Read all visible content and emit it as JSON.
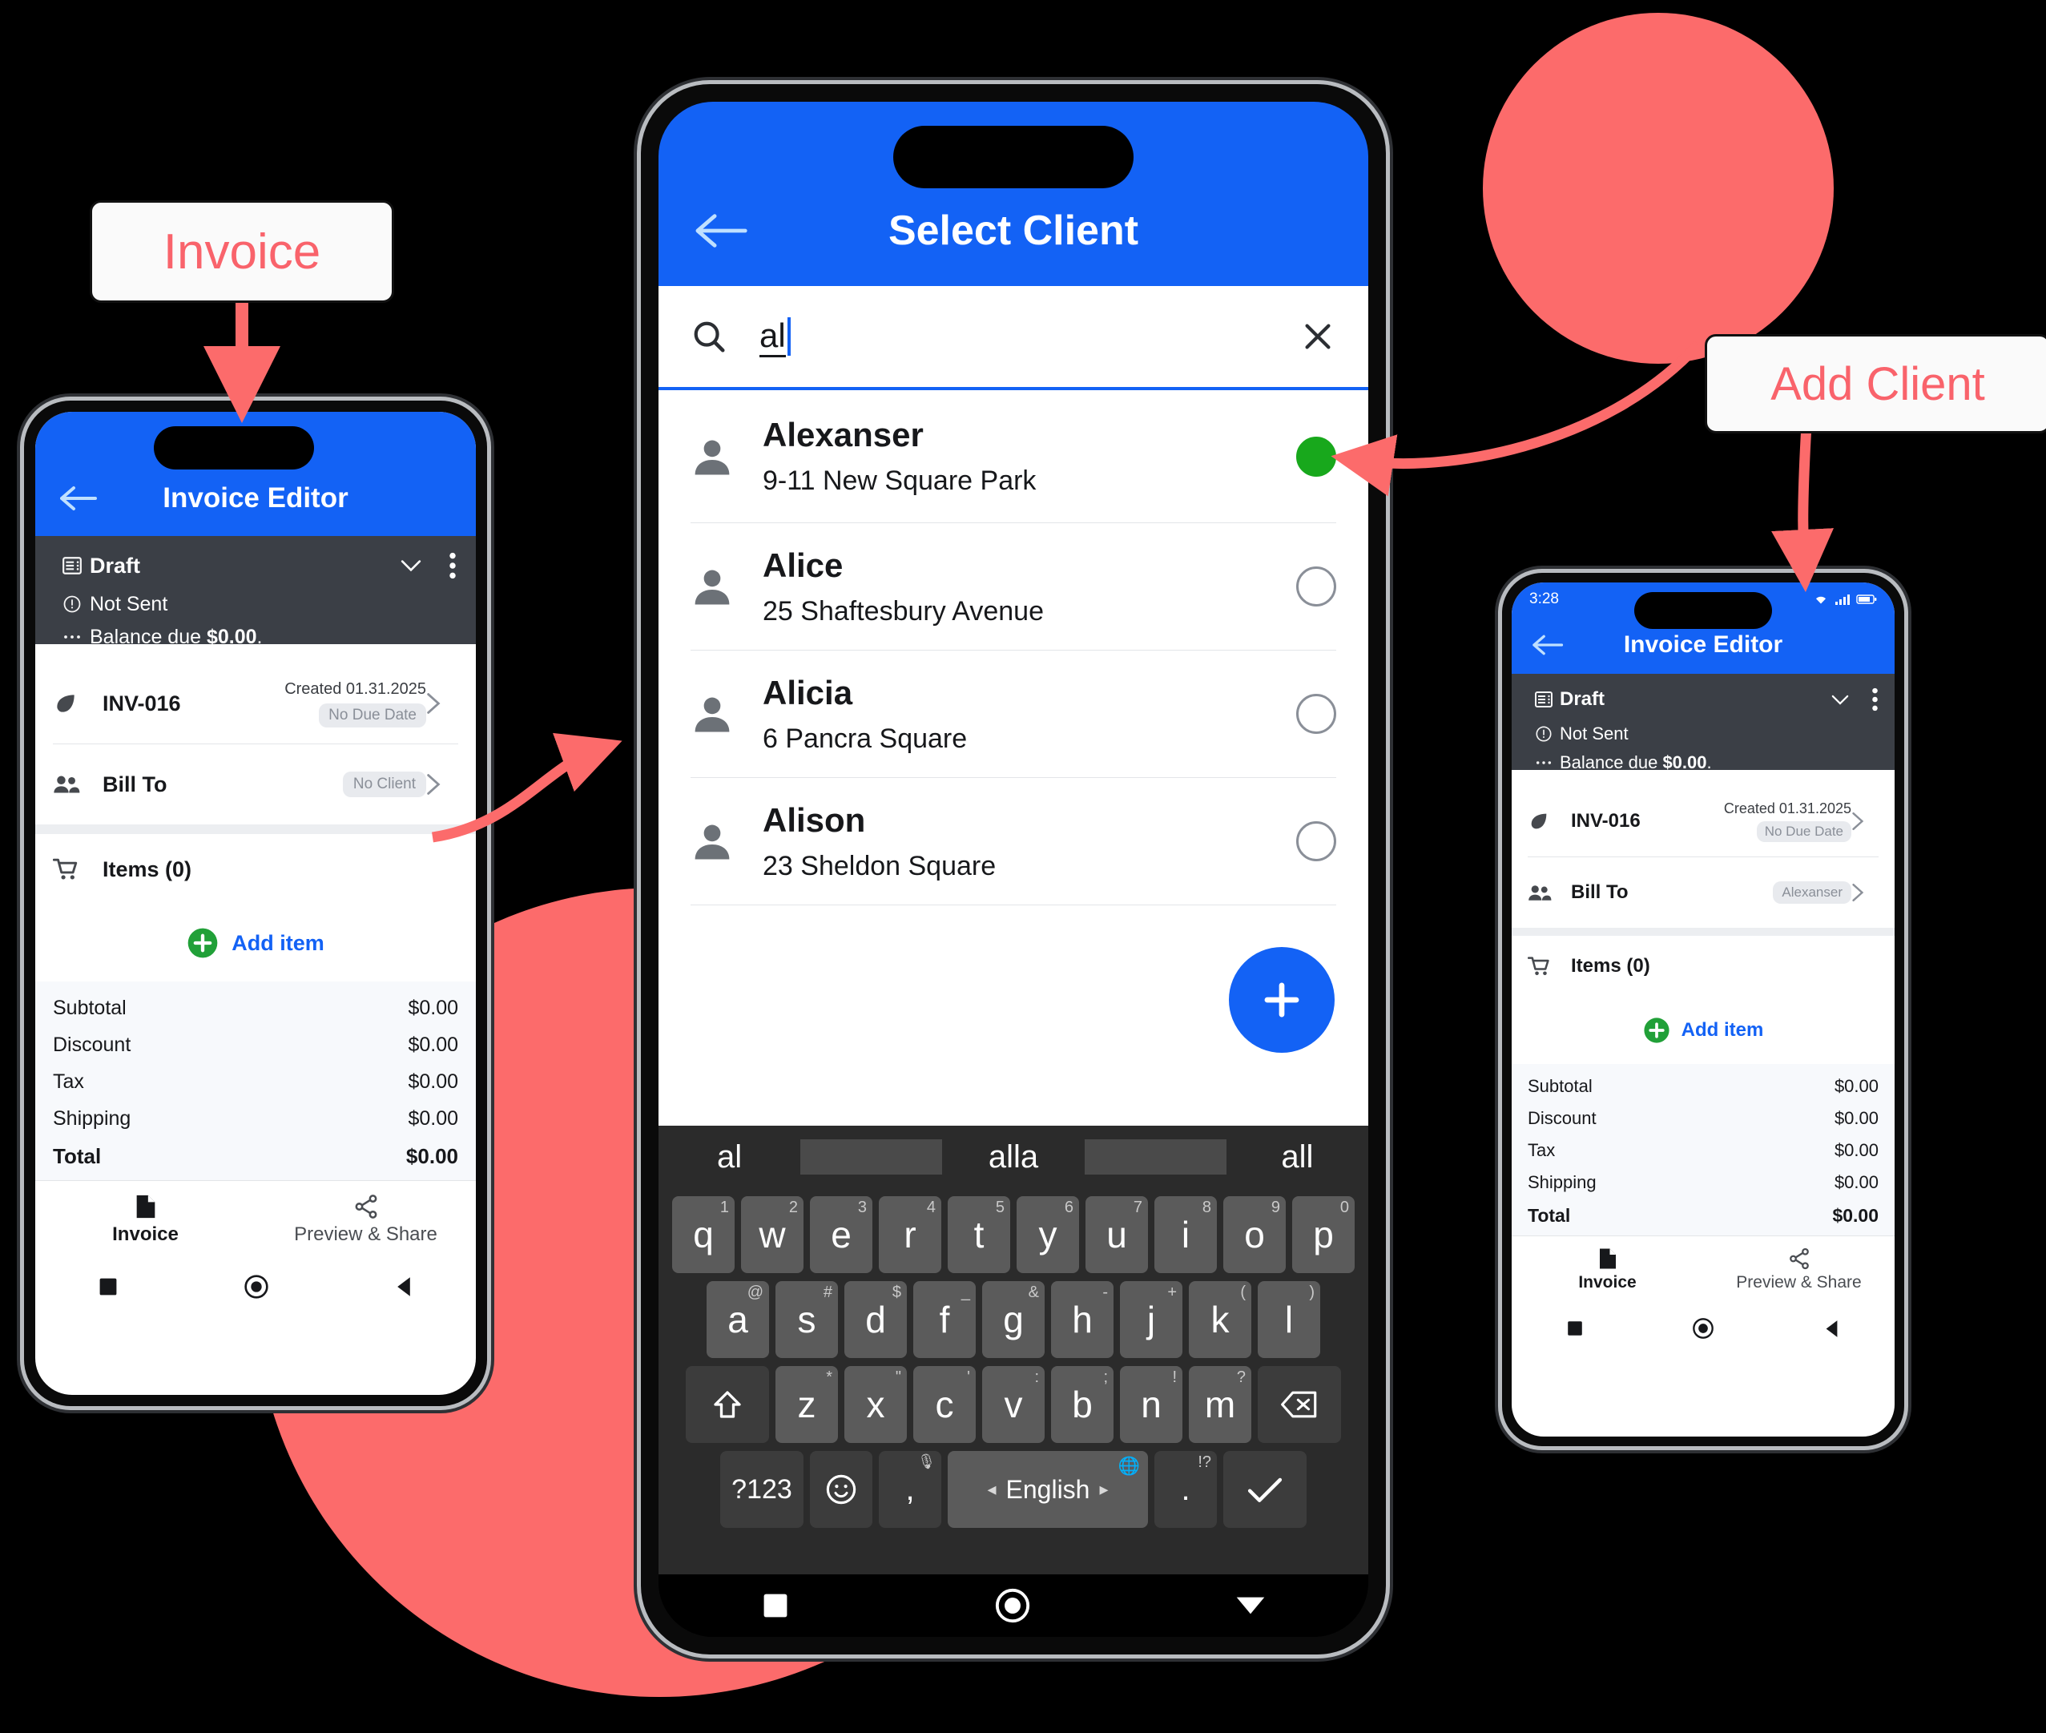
{
  "theme": {
    "brand_blue": "#1362F5",
    "coral": "#FC6B6B",
    "callout_text": "#F9636B",
    "selected_green": "#18A81C",
    "dark_panel": "#3B3F46"
  },
  "callouts": [
    {
      "id": "invoice",
      "label": "Invoice"
    },
    {
      "id": "add_client",
      "label": "Add Client"
    }
  ],
  "invoice_editor": {
    "appbar": {
      "back_icon": "arrow-left-icon",
      "title": "Invoice Editor"
    },
    "status": {
      "doc_icon": "document-list-icon",
      "state": "Draft",
      "chevron_icon": "chevron-down-icon",
      "overflow_icon": "more-vertical-icon",
      "sent_icon": "alert-circle-icon",
      "sent_status": "Not Sent",
      "balance_icon": "ellipsis-icon",
      "balance_label": "Balance due ",
      "balance_amount": "$0.00",
      "balance_suffix": "."
    },
    "rows": [
      {
        "icon": "leaf-icon",
        "label": "INV-016",
        "meta_top": "Created 01.31.2025",
        "meta_chip": "No Due Date",
        "chevron": "chevron-right-icon"
      },
      {
        "icon": "people-icon",
        "label": "Bill To",
        "meta_chip": "No Client",
        "chevron": "chevron-right-icon"
      }
    ],
    "items": {
      "icon": "cart-icon",
      "title": "Items (0)",
      "add_icon": "plus-circle-icon",
      "add_label": "Add item"
    },
    "totals": [
      {
        "label": "Subtotal",
        "value": "$0.00",
        "bold": false
      },
      {
        "label": "Discount",
        "value": "$0.00",
        "bold": false
      },
      {
        "label": "Tax",
        "value": "$0.00",
        "bold": false
      },
      {
        "label": "Shipping",
        "value": "$0.00",
        "bold": false
      },
      {
        "label": "Total",
        "value": "$0.00",
        "bold": true
      }
    ],
    "bottom_tabs": [
      {
        "icon": "invoice-doc-icon",
        "label": "Invoice",
        "active": true
      },
      {
        "icon": "share-icon",
        "label": "Preview & Share",
        "active": false
      }
    ],
    "nav": {
      "recents_icon": "square-icon",
      "home_icon": "circle-icon",
      "back_icon": "triangle-back-icon"
    }
  },
  "select_client": {
    "appbar": {
      "back_icon": "arrow-left-icon",
      "title": "Select Client"
    },
    "search": {
      "icon": "search-icon",
      "value": "al",
      "clear_icon": "close-icon"
    },
    "clients": [
      {
        "avatar": "person-icon",
        "name": "Alexanser",
        "address": "9-11 New Square Park",
        "selected": true
      },
      {
        "avatar": "person-icon",
        "name": "Alice",
        "address": "25 Shaftesbury Avenue",
        "selected": false
      },
      {
        "avatar": "person-icon",
        "name": "Alicia",
        "address": "6 Pancra Square",
        "selected": false
      },
      {
        "avatar": "person-icon",
        "name": "Alison",
        "address": "23 Sheldon Square",
        "selected": false
      }
    ],
    "fab": {
      "icon": "plus-icon"
    },
    "keyboard": {
      "suggestions": [
        "al",
        "alla",
        "all"
      ],
      "row1": [
        {
          "k": "q",
          "sup": "1"
        },
        {
          "k": "w",
          "sup": "2"
        },
        {
          "k": "e",
          "sup": "3"
        },
        {
          "k": "r",
          "sup": "4"
        },
        {
          "k": "t",
          "sup": "5"
        },
        {
          "k": "y",
          "sup": "6"
        },
        {
          "k": "u",
          "sup": "7"
        },
        {
          "k": "i",
          "sup": "8"
        },
        {
          "k": "o",
          "sup": "9"
        },
        {
          "k": "p",
          "sup": "0"
        }
      ],
      "row2": [
        {
          "k": "a",
          "sup": "@"
        },
        {
          "k": "s",
          "sup": "#"
        },
        {
          "k": "d",
          "sup": "$"
        },
        {
          "k": "f",
          "sup": "_"
        },
        {
          "k": "g",
          "sup": "&"
        },
        {
          "k": "h",
          "sup": "-"
        },
        {
          "k": "j",
          "sup": "+"
        },
        {
          "k": "k",
          "sup": "("
        },
        {
          "k": "l",
          "sup": ")"
        }
      ],
      "row3": [
        {
          "k": "z",
          "sup": "*"
        },
        {
          "k": "x",
          "sup": "\""
        },
        {
          "k": "c",
          "sup": "'"
        },
        {
          "k": "v",
          "sup": ":"
        },
        {
          "k": "b",
          "sup": ";"
        },
        {
          "k": "n",
          "sup": "!"
        },
        {
          "k": "m",
          "sup": "?"
        }
      ],
      "shift_icon": "shift-icon",
      "backspace_icon": "backspace-icon",
      "symbols_key": "?123",
      "emoji_icon": "emoji-icon",
      "comma_key": ",",
      "comma_sup": "mic-icon",
      "space_label": "English",
      "space_left_icon": "chevron-left-icon",
      "space_right_icon": "chevron-right-icon",
      "globe_icon": "globe-icon",
      "period_key": ".",
      "period_sup": "!?",
      "enter_icon": "check-icon"
    },
    "nav": {
      "recents_icon": "square-icon",
      "home_icon": "circle-icon",
      "back_icon": "triangle-down-icon"
    }
  },
  "invoice_editor_filled": {
    "statusbar": {
      "time": "3:28",
      "icons": [
        "wifi-icon",
        "signal-icon",
        "battery-icon"
      ]
    },
    "appbar": {
      "back_icon": "arrow-left-icon",
      "title": "Invoice Editor"
    },
    "status": {
      "doc_icon": "document-list-icon",
      "state": "Draft",
      "chevron_icon": "chevron-down-icon",
      "overflow_icon": "more-vertical-icon",
      "sent_icon": "alert-circle-icon",
      "sent_status": "Not Sent",
      "balance_icon": "ellipsis-icon",
      "balance_label": "Balance due ",
      "balance_amount": "$0.00",
      "balance_suffix": "."
    },
    "rows": [
      {
        "icon": "leaf-icon",
        "label": "INV-016",
        "meta_top": "Created 01.31.2025",
        "meta_chip": "No Due Date",
        "chevron": "chevron-right-icon"
      },
      {
        "icon": "people-icon",
        "label": "Bill To",
        "meta_chip": "Alexanser",
        "chevron": "chevron-right-icon"
      }
    ],
    "items": {
      "icon": "cart-icon",
      "title": "Items (0)",
      "add_icon": "plus-circle-icon",
      "add_label": "Add item"
    },
    "totals": [
      {
        "label": "Subtotal",
        "value": "$0.00",
        "bold": false
      },
      {
        "label": "Discount",
        "value": "$0.00",
        "bold": false
      },
      {
        "label": "Tax",
        "value": "$0.00",
        "bold": false
      },
      {
        "label": "Shipping",
        "value": "$0.00",
        "bold": false
      },
      {
        "label": "Total",
        "value": "$0.00",
        "bold": true
      }
    ],
    "bottom_tabs": [
      {
        "icon": "invoice-doc-icon",
        "label": "Invoice",
        "active": true
      },
      {
        "icon": "share-icon",
        "label": "Preview & Share",
        "active": false
      }
    ],
    "nav": {
      "recents_icon": "square-icon",
      "home_icon": "circle-icon",
      "back_icon": "triangle-back-icon"
    }
  }
}
